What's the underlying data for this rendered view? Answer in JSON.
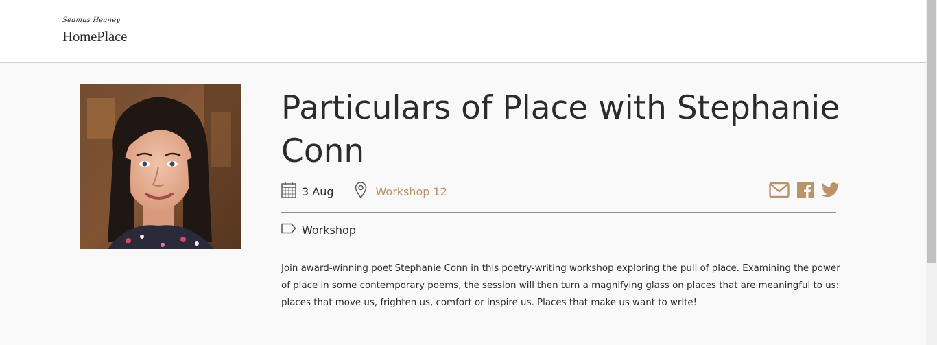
{
  "header": {
    "logo_script": "Seamus Heaney",
    "logo_main": "HomePlace"
  },
  "event": {
    "title": "Particulars of Place with Stephanie Conn",
    "date": "3 Aug",
    "venue": "Workshop 12",
    "category": "Workshop",
    "description": "Join award-winning poet Stephanie Conn in this poetry-writing workshop exploring the pull of place. Examining the power of place in some contemporary poems, the session will then turn a magnifying glass on places that are meaningful to us: places that move us, frighten us, comfort or inspire us. Places that make us want to write!"
  },
  "icons": {
    "date": "calendar-icon",
    "venue": "location-pin-icon",
    "category": "tag-icon",
    "share": [
      "email-icon",
      "facebook-icon",
      "twitter-icon"
    ]
  },
  "colors": {
    "accent": "#b89466",
    "text": "#2b2b2b",
    "page_background": "#f9f9f9",
    "header_background": "#ffffff"
  }
}
